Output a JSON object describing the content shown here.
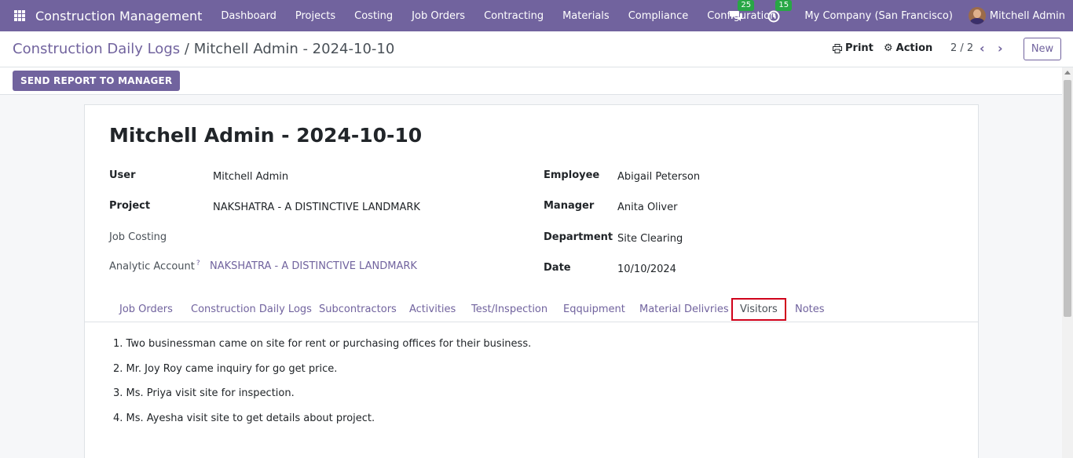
{
  "navbar": {
    "app_name": "Construction Management",
    "menu": [
      "Dashboard",
      "Projects",
      "Costing",
      "Job Orders",
      "Contracting",
      "Materials",
      "Compliance",
      "Configuration"
    ],
    "messages_badge": "25",
    "activity_badge": "15",
    "company": "My Company (San Francisco)",
    "user": "Mitchell Admin"
  },
  "control": {
    "breadcrumb_parent": "Construction Daily Logs",
    "breadcrumb_sep": "/",
    "breadcrumb_current": "Mitchell Admin - 2024-10-10",
    "print_label": "Print",
    "action_label": "Action",
    "pager": "2 / 2",
    "new_label": "New"
  },
  "statusbar": {
    "send_label": "SEND REPORT TO MANAGER"
  },
  "record": {
    "title": "Mitchell Admin - 2024-10-10",
    "left": [
      {
        "label": "User",
        "value": "Mitchell Admin"
      },
      {
        "label": "Project",
        "value": "NAKSHATRA - A DISTINCTIVE LANDMARK"
      },
      {
        "label": "Job Costing",
        "value": ""
      },
      {
        "label": "Analytic Account",
        "help": "?",
        "value": "NAKSHATRA - A DISTINCTIVE LANDMARK"
      }
    ],
    "right": [
      {
        "label": "Employee",
        "value": "Abigail Peterson"
      },
      {
        "label": "Manager",
        "value": "Anita Oliver"
      },
      {
        "label": "Department",
        "value": "Site Clearing"
      },
      {
        "label": "Date",
        "value": "10/10/2024"
      }
    ]
  },
  "tabs": [
    "Job Orders",
    "Construction Daily Logs",
    "Subcontractors",
    "Activities",
    "Test/Inspection",
    "Eqquipment",
    "Material Delivries",
    "Visitors",
    "Notes"
  ],
  "active_tab": "Visitors",
  "visitors_notes": [
    "1. Two businessman came on site for rent or purchasing offices for their business.",
    "2. Mr. Joy Roy came inquiry for go get price.",
    "3. Ms. Priya visit site for inspection.",
    "4. Ms. Ayesha visit site to get details about project."
  ],
  "colors": {
    "brand": "#71639e",
    "badge": "#28a745",
    "highlight": "#d0021b"
  }
}
